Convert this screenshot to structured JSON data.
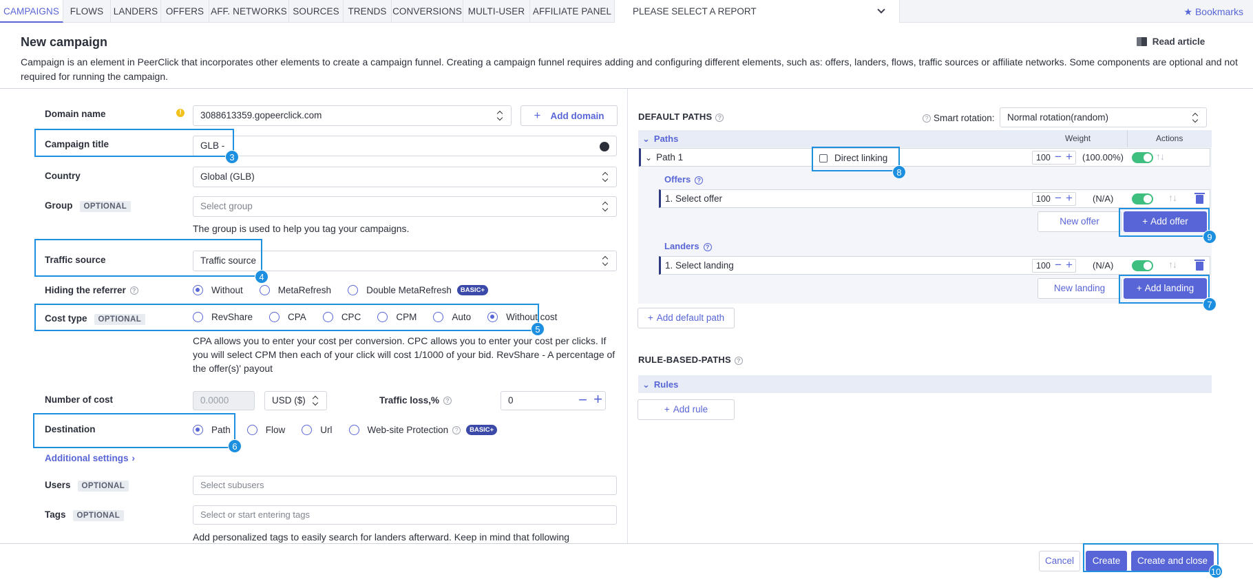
{
  "nav": {
    "tabs": [
      "CAMPAIGNS",
      "FLOWS",
      "LANDERS",
      "OFFERS",
      "AFF. NETWORKS",
      "SOURCES",
      "TRENDS",
      "CONVERSIONS",
      "MULTI-USER",
      "AFFILIATE PANEL"
    ],
    "report_select": "PLEASE SELECT A REPORT",
    "bookmarks": "Bookmarks"
  },
  "header": {
    "title": "New campaign",
    "read_article": "Read article",
    "description": "Campaign is an element in PeerClick that incorporates other elements to create a campaign funnel. Creating a campaign funnel requires adding and configuring different elements, such as: offers, landers, flows, traffic sources or affiliate networks. Some components are optional and not required for running the campaign."
  },
  "form": {
    "optional_label": "OPTIONAL",
    "domain": {
      "label": "Domain name",
      "value": "3088613359.gopeerclick.com",
      "add_button": "Add domain"
    },
    "campaign_title": {
      "label": "Campaign title",
      "value": "GLB -"
    },
    "country": {
      "label": "Country",
      "value": "Global (GLB)"
    },
    "group": {
      "label": "Group",
      "placeholder": "Select group",
      "hint": "The group is used to help you tag your campaigns."
    },
    "traffic_source": {
      "label": "Traffic source",
      "value": "Traffic source"
    },
    "hiding_referrer": {
      "label": "Hiding the referrer",
      "options": [
        "Without",
        "MetaRefresh",
        "Double MetaRefresh"
      ],
      "badge": "BASIC+"
    },
    "cost_type": {
      "label": "Cost type",
      "options": [
        "RevShare",
        "CPA",
        "CPC",
        "CPM",
        "Auto",
        "Without cost"
      ],
      "hint": "CPA allows you to enter your cost per conversion. CPC allows you to enter your cost per clicks. If you will select CPM then each of your click will cost 1/1000 of your bid. RevShare - A percentage of the offer(s)' payout"
    },
    "number_of_cost": {
      "label": "Number of cost",
      "placeholder": "0.0000",
      "currency": "USD ($)"
    },
    "traffic_loss": {
      "label": "Traffic loss,%",
      "value": "0"
    },
    "destination": {
      "label": "Destination",
      "options": [
        "Path",
        "Flow",
        "Url",
        "Web-site Protection"
      ],
      "badge": "BASIC+"
    },
    "additional_settings": "Additional settings",
    "users": {
      "label": "Users",
      "placeholder": "Select subusers"
    },
    "tags": {
      "label": "Tags",
      "placeholder": "Select or start entering tags",
      "hint": "Add personalized tags to easily search for landers afterward. Keep in mind that following"
    }
  },
  "right": {
    "default_paths_title": "DEFAULT PATHS",
    "smart_rotation_label": "Smart rotation:",
    "smart_rotation_value": "Normal rotation(random)",
    "paths_label": "Paths",
    "weight_header": "Weight",
    "actions_header": "Actions",
    "path1": {
      "name": "Path 1",
      "direct_linking": "Direct linking",
      "weight": "100",
      "percent": "(100.00%)"
    },
    "offers_label": "Offers",
    "offer_row": {
      "name": "1. Select offer",
      "weight": "100",
      "percent": "(N/A)"
    },
    "new_offer": "New offer",
    "add_offer": "Add offer",
    "landers_label": "Landers",
    "lander_row": {
      "name": "1. Select landing",
      "weight": "100",
      "percent": "(N/A)"
    },
    "new_landing": "New landing",
    "add_landing": "Add landing",
    "add_default_path": "Add default path",
    "rule_based_title": "RULE-BASED-PATHS",
    "rules_label": "Rules",
    "add_rule": "Add rule"
  },
  "footer": {
    "cancel": "Cancel",
    "create": "Create",
    "create_close": "Create and close"
  },
  "annotations": [
    "3",
    "4",
    "5",
    "6",
    "7",
    "8",
    "9",
    "10"
  ]
}
